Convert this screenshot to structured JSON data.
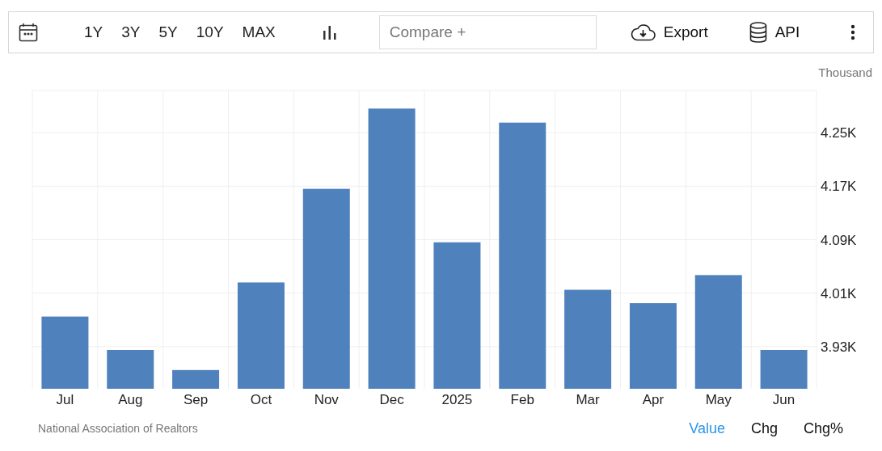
{
  "toolbar": {
    "ranges": [
      "1Y",
      "3Y",
      "5Y",
      "10Y",
      "MAX"
    ],
    "compare": {
      "placeholder": "Compare +"
    },
    "export": "Export",
    "api": "API"
  },
  "chart": {
    "unit": "Thousand",
    "chart_data": {
      "type": "bar",
      "categories": [
        "Jul",
        "Aug",
        "Sep",
        "Oct",
        "Nov",
        "Dec",
        "2025",
        "Feb",
        "Mar",
        "Apr",
        "May",
        "Jun"
      ],
      "grid": true,
      "series": [
        {
          "color": "#4f81bd",
          "values": [
            3.975,
            3.925,
            3.895,
            4.026,
            4.166,
            4.286,
            4.086,
            4.265,
            4.015,
            3.995,
            4.037,
            3.925
          ]
        }
      ],
      "ylim": [
        3.867,
        4.313
      ],
      "yticks": [
        {
          "value": 3.93,
          "label": "3.93K"
        },
        {
          "value": 4.01,
          "label": "4.01K"
        },
        {
          "value": 4.09,
          "label": "4.09K"
        },
        {
          "value": 4.17,
          "label": "4.17K"
        },
        {
          "value": 4.25,
          "label": "4.25K"
        }
      ]
    }
  },
  "footer": {
    "source": "National Association of Realtors",
    "views": [
      {
        "label": "Value",
        "selected": true
      },
      {
        "label": "Chg",
        "selected": false
      },
      {
        "label": "Chg%",
        "selected": false
      }
    ]
  }
}
